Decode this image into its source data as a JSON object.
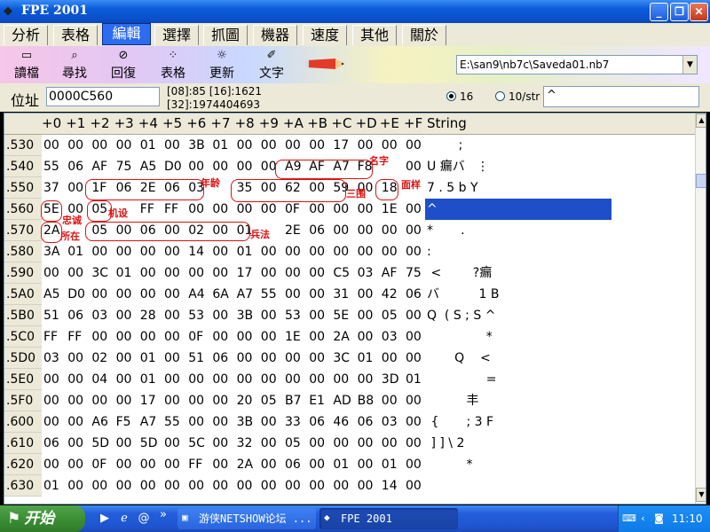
{
  "window": {
    "title": "FPE 2001",
    "minimize": "_",
    "restore": "❐",
    "close": "✕"
  },
  "tabs": [
    "分析",
    "表格",
    "編輯",
    "選擇",
    "抓圖",
    "機器",
    "速度",
    "其他",
    "關於"
  ],
  "active_tab_index": 2,
  "toolbar": {
    "buttons": [
      {
        "label": "讀檔",
        "icon": "open-folder-icon",
        "glyph": "▭"
      },
      {
        "label": "尋找",
        "icon": "find-icon",
        "glyph": "⌕"
      },
      {
        "label": "回復",
        "icon": "undo-icon",
        "glyph": "⊘"
      },
      {
        "label": "表格",
        "icon": "table-icon",
        "glyph": "⁘"
      },
      {
        "label": "更新",
        "icon": "update-icon",
        "glyph": "☼"
      },
      {
        "label": "文字",
        "icon": "text-icon",
        "glyph": "✐"
      }
    ],
    "path": "E:\\san9\\nb7c\\Saveda01.nb7"
  },
  "address": {
    "label": "位址",
    "value": "0000C560",
    "info_line1": "[08]:85  [16]:1621",
    "info_line2": "[32]:1974404693",
    "radio_16": "16",
    "radio_10": "10/str",
    "selected_radix": "16",
    "string_input": "^"
  },
  "grid": {
    "columns": [
      "+0",
      "+1",
      "+2",
      "+3",
      "+4",
      "+5",
      "+6",
      "+7",
      "+8",
      "+9",
      "+A",
      "+B",
      "+C",
      "+D",
      "+E",
      "+F"
    ],
    "string_header": "String",
    "selected_row": ".560",
    "rows": [
      {
        "addr": ".530",
        "bytes": [
          "00",
          "00",
          "00",
          "00",
          "01",
          "00",
          "3B",
          "01",
          "00",
          "00",
          "00",
          "00",
          "17",
          "00",
          "00",
          "00"
        ],
        "str": "        ;"
      },
      {
        "addr": ".540",
        "bytes": [
          "55",
          "06",
          "AF",
          "75",
          "A5",
          "D0",
          "00",
          "00",
          "00",
          "00",
          "A9",
          "AF",
          "A7",
          "F8",
          "",
          "00"
        ],
        "str": "U 瘺バ   ⋮"
      },
      {
        "addr": ".550",
        "bytes": [
          "37",
          "00",
          "1F",
          "06",
          "2E",
          "06",
          "03",
          "",
          "35",
          "00",
          "62",
          "00",
          "59",
          "00",
          "18",
          ""
        ],
        "str": "7 . 5 b Y"
      },
      {
        "addr": ".560",
        "bytes": [
          "5E",
          "00",
          "05",
          "",
          "FF",
          "FF",
          "00",
          "00",
          "00",
          "00",
          "0F",
          "00",
          "00",
          "00",
          "1E",
          "00"
        ],
        "str": "^"
      },
      {
        "addr": ".570",
        "bytes": [
          "2A",
          "",
          "05",
          "00",
          "06",
          "00",
          "02",
          "00",
          "01",
          "",
          "2E",
          "06",
          "00",
          "00",
          "00",
          "00"
        ],
        "str": "*       ."
      },
      {
        "addr": ".580",
        "bytes": [
          "3A",
          "01",
          "00",
          "00",
          "00",
          "00",
          "14",
          "00",
          "01",
          "00",
          "00",
          "00",
          "00",
          "00",
          "00",
          "00"
        ],
        "str": ":"
      },
      {
        "addr": ".590",
        "bytes": [
          "00",
          "00",
          "3C",
          "01",
          "00",
          "00",
          "00",
          "00",
          "17",
          "00",
          "00",
          "00",
          "C5",
          "03",
          "AF",
          "75"
        ],
        "str": " <        ?瘺"
      },
      {
        "addr": ".5A0",
        "bytes": [
          "A5",
          "D0",
          "00",
          "00",
          "00",
          "00",
          "A4",
          "6A",
          "A7",
          "55",
          "00",
          "00",
          "31",
          "00",
          "42",
          "06"
        ],
        "str": "バ          1 B"
      },
      {
        "addr": ".5B0",
        "bytes": [
          "51",
          "06",
          "03",
          "00",
          "28",
          "00",
          "53",
          "00",
          "3B",
          "00",
          "53",
          "00",
          "5E",
          "00",
          "05",
          "00"
        ],
        "str": "Q  ( S ; S ^"
      },
      {
        "addr": ".5C0",
        "bytes": [
          "FF",
          "FF",
          "00",
          "00",
          "00",
          "00",
          "0F",
          "00",
          "00",
          "00",
          "1E",
          "00",
          "2A",
          "00",
          "03",
          "00"
        ],
        "str": "               *"
      },
      {
        "addr": ".5D0",
        "bytes": [
          "03",
          "00",
          "02",
          "00",
          "01",
          "00",
          "51",
          "06",
          "00",
          "00",
          "00",
          "00",
          "3C",
          "01",
          "00",
          "00"
        ],
        "str": "       Q    <"
      },
      {
        "addr": ".5E0",
        "bytes": [
          "00",
          "00",
          "04",
          "00",
          "01",
          "00",
          "00",
          "00",
          "00",
          "00",
          "00",
          "00",
          "00",
          "00",
          "3D",
          "01"
        ],
        "str": "               ="
      },
      {
        "addr": ".5F0",
        "bytes": [
          "00",
          "00",
          "00",
          "00",
          "17",
          "00",
          "00",
          "00",
          "20",
          "05",
          "B7",
          "E1",
          "AD",
          "B8",
          "00",
          "00"
        ],
        "str": "          丰"
      },
      {
        "addr": ".600",
        "bytes": [
          "00",
          "00",
          "A6",
          "F5",
          "A7",
          "55",
          "00",
          "00",
          "3B",
          "00",
          "33",
          "06",
          "46",
          "06",
          "03",
          "00"
        ],
        "str": " {       ; 3 F"
      },
      {
        "addr": ".610",
        "bytes": [
          "06",
          "00",
          "5D",
          "00",
          "5D",
          "00",
          "5C",
          "00",
          "32",
          "00",
          "05",
          "00",
          "00",
          "00",
          "00",
          "00"
        ],
        "str": " ] ] \\ 2"
      },
      {
        "addr": ".620",
        "bytes": [
          "00",
          "00",
          "0F",
          "00",
          "00",
          "00",
          "FF",
          "00",
          "2A",
          "00",
          "06",
          "00",
          "01",
          "00",
          "01",
          "00"
        ],
        "str": "          *"
      },
      {
        "addr": ".630",
        "bytes": [
          "01",
          "00",
          "00",
          "00",
          "00",
          "00",
          "00",
          "00",
          "00",
          "00",
          "00",
          "00",
          "00",
          "00",
          "14",
          "00"
        ],
        "str": ""
      }
    ]
  },
  "annotations": {
    "age": "年龄",
    "name": "名字",
    "three_sides": "三围",
    "appearance": "面样",
    "loyalty": "忠诚",
    "location": "所在",
    "skills": "机设",
    "army": "兵法"
  },
  "taskbar": {
    "start_label": "开始",
    "chevron": "»",
    "tasks": [
      {
        "label": "游侠NETSHOW论坛 ...",
        "icon": "browser-window-icon"
      },
      {
        "label": "FPE 2001",
        "icon": "fpe-app-icon"
      }
    ],
    "clock": "11:10"
  },
  "colors": {
    "accent": "#2c6df0",
    "selection": "#1f4fc8",
    "annotation": "#e01010",
    "titlebar": "#0b4fc8"
  }
}
